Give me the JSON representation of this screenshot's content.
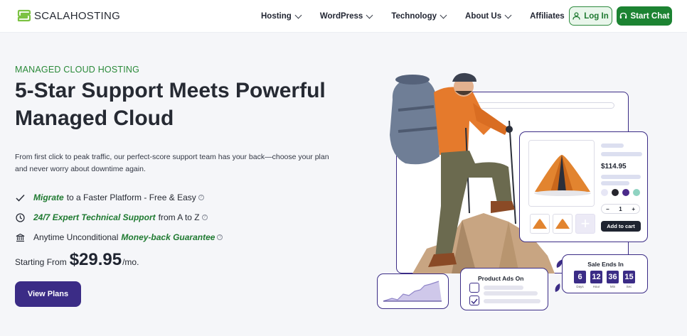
{
  "header": {
    "logo_text": "SCALAHOSTING",
    "nav": [
      {
        "label": "Hosting",
        "has_dropdown": true
      },
      {
        "label": "WordPress",
        "has_dropdown": true
      },
      {
        "label": "Technology",
        "has_dropdown": true
      },
      {
        "label": "About Us",
        "has_dropdown": true
      },
      {
        "label": "Affiliates",
        "has_dropdown": false
      }
    ],
    "login_label": "Log In",
    "chat_label": "Start Chat"
  },
  "hero": {
    "eyebrow": "MANAGED CLOUD HOSTING",
    "headline": "5-Star Support Meets Powerful Managed Cloud",
    "description": "From first click to peak traffic, our perfect-score support team has your back—choose your plan and never worry about downtime again.",
    "features": [
      {
        "icon": "check-icon",
        "pre": "",
        "highlight": "Migrate",
        "post": "to a Faster Platform - Free & Easy"
      },
      {
        "icon": "clock-icon",
        "pre": "",
        "highlight": "24/7 Expert Technical Support",
        "post": "from A to Z"
      },
      {
        "icon": "bank-icon",
        "pre": "Anytime Unconditional",
        "highlight": "Money-back Guarantee",
        "post": ""
      }
    ],
    "price_prefix": "Starting From",
    "price": "$29.95",
    "price_suffix": "/mo.",
    "cta_label": "View Plans"
  },
  "illustration": {
    "product_price": "$114.95",
    "quantity": "1",
    "add_to_cart": "Add to cart",
    "swatch_colors": [
      "#e6e6f5",
      "#26252d",
      "#4b2a8a",
      "#8fd3c1"
    ],
    "sale_title": "Sale Ends In",
    "countdown": [
      {
        "value": "6",
        "unit": "Days"
      },
      {
        "value": "12",
        "unit": "Hour"
      },
      {
        "value": "36",
        "unit": "Min"
      },
      {
        "value": "15",
        "unit": "Sec"
      }
    ],
    "ads_title": "Product Ads On"
  },
  "colors": {
    "brand_green": "#1c8332",
    "brand_purple": "#3b2c86"
  }
}
